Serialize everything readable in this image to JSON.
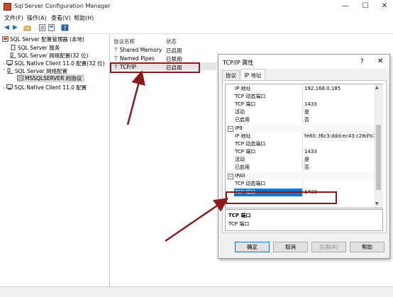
{
  "window": {
    "title": "Sql Server Configuration Manager",
    "minimize": "—",
    "maximize": "☐",
    "close": "✕"
  },
  "menu": [
    "文件(F)",
    "操作(A)",
    "查看(V)",
    "帮助(H)"
  ],
  "toolbar": [
    "back-icon",
    "forward-icon",
    "folder-icon",
    "properties-icon",
    "export-icon",
    "help-icon"
  ],
  "tree": {
    "root": "SQL Server 配置管理器 (本地)",
    "items": [
      "SQL Server 服务",
      "SQL Server 网络配置(32 位)",
      "SQL Native Client 11.0 配置(32 位)",
      "SQL Server 网络配置",
      "MSSQLSERVER 的协议",
      "SQL Native Client 11.0 配置"
    ]
  },
  "list": {
    "headers": [
      "协议名称",
      "状态"
    ],
    "rows": [
      {
        "name": "Shared Memory",
        "status": "已启用"
      },
      {
        "name": "Named Pipes",
        "status": "已禁用"
      },
      {
        "name": "TCP/IP",
        "status": "已启用"
      }
    ]
  },
  "dialog": {
    "title": "TCP/IP 属性",
    "help": "?",
    "close": "✕",
    "tabs": [
      "协议",
      "IP 地址"
    ],
    "top_rows": [
      {
        "name": "IP 地址",
        "value": "192.168.0.185"
      },
      {
        "name": "TCP 动态端口",
        "value": ""
      },
      {
        "name": "TCP 端口",
        "value": "1433"
      },
      {
        "name": "活动",
        "value": "是"
      },
      {
        "name": "已启用",
        "value": "否"
      }
    ],
    "group_ip9": "IP9",
    "ip9_rows": [
      {
        "name": "IP 地址",
        "value": "fe80::f6c3:ddd:ec43:c28d%7"
      },
      {
        "name": "TCP 动态端口",
        "value": ""
      },
      {
        "name": "TCP 端口",
        "value": "1433"
      },
      {
        "name": "活动",
        "value": "是"
      },
      {
        "name": "已启用",
        "value": "否"
      }
    ],
    "group_ipall": "IPAll",
    "ipall_rows": [
      {
        "name": "TCP 动态端口",
        "value": ""
      },
      {
        "name": "TCP 端口",
        "value": "1433"
      }
    ],
    "description_title": "TCP 端口",
    "description_text": "TCP 端口",
    "buttons": {
      "ok": "确定",
      "cancel": "取消",
      "apply": "应用(A)",
      "help": "帮助"
    }
  },
  "colors": {
    "highlight": "#0078d7",
    "annotation": "#8b1a1a"
  }
}
